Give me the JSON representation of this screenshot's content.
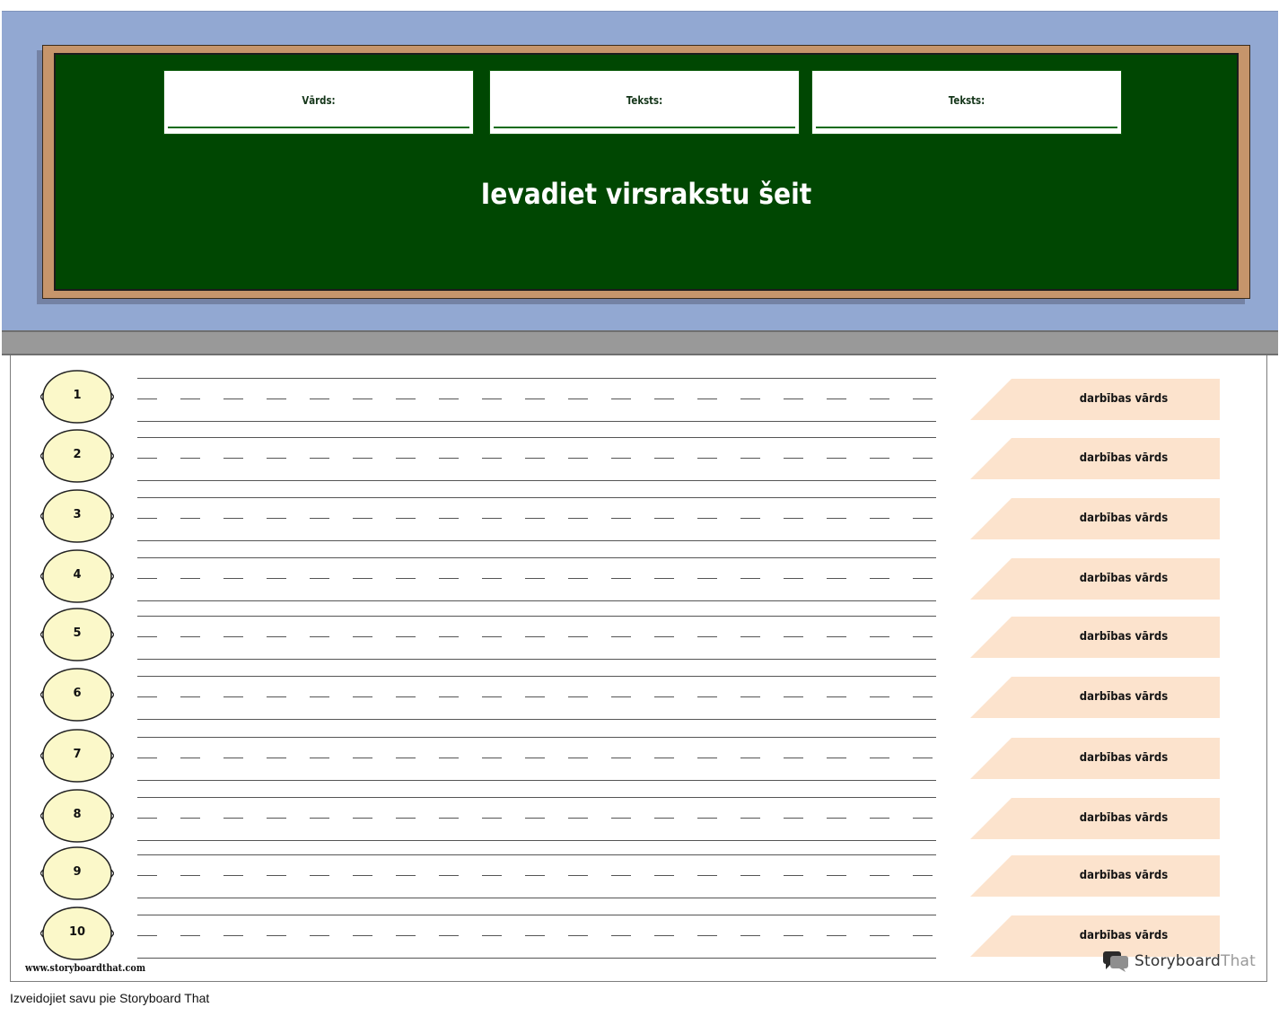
{
  "header": {
    "fields": [
      {
        "label": "Vārds:"
      },
      {
        "label": "Teksts:"
      },
      {
        "label": "Teksts:"
      }
    ],
    "title": "Ievadiet virsrakstu šeit"
  },
  "rows": [
    {
      "number": "1",
      "verb": "darbības vārds"
    },
    {
      "number": "2",
      "verb": "darbības vārds"
    },
    {
      "number": "3",
      "verb": "darbības vārds"
    },
    {
      "number": "4",
      "verb": "darbības vārds"
    },
    {
      "number": "5",
      "verb": "darbības vārds"
    },
    {
      "number": "6",
      "verb": "darbības vārds"
    },
    {
      "number": "7",
      "verb": "darbības vārds"
    },
    {
      "number": "8",
      "verb": "darbības vārds"
    },
    {
      "number": "9",
      "verb": "darbības vārds"
    },
    {
      "number": "10",
      "verb": "darbības vārds"
    }
  ],
  "branding": {
    "url": "www.storyboardthat.com",
    "logo_word_a": "Storyboard",
    "logo_word_b": "That"
  },
  "footer": {
    "text": "Izveidojiet savu pie Storyboard That"
  },
  "colors": {
    "wall": "#92a8d2",
    "chalkboard": "#004702",
    "frame": "#c6956b",
    "number_circle": "#fbf8c9",
    "verb_tag": "#fce3cd"
  }
}
